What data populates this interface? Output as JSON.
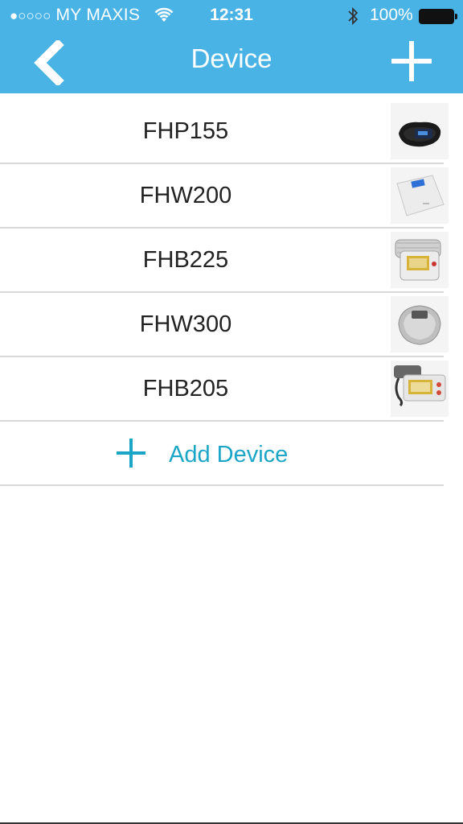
{
  "status_bar": {
    "signal": "●○○○○",
    "carrier": "MY MAXIS",
    "time": "12:31",
    "battery_percent": "100%"
  },
  "navbar": {
    "title": "Device",
    "back_icon": "chevron-left-icon",
    "add_icon": "plus-icon"
  },
  "devices": [
    {
      "name": "FHP155",
      "thumbnail": "fitness-band"
    },
    {
      "name": "FHW200",
      "thumbnail": "bathroom-scale"
    },
    {
      "name": "FHB225",
      "thumbnail": "wrist-blood-pressure-monitor"
    },
    {
      "name": "FHW300",
      "thumbnail": "body-fat-scale"
    },
    {
      "name": "FHB205",
      "thumbnail": "arm-blood-pressure-monitor"
    }
  ],
  "add_device": {
    "label": "Add Device",
    "icon": "plus-icon"
  },
  "colors": {
    "header": "#4ab3e6",
    "accent": "#1ba6c7",
    "divider": "#d8d8d8"
  }
}
